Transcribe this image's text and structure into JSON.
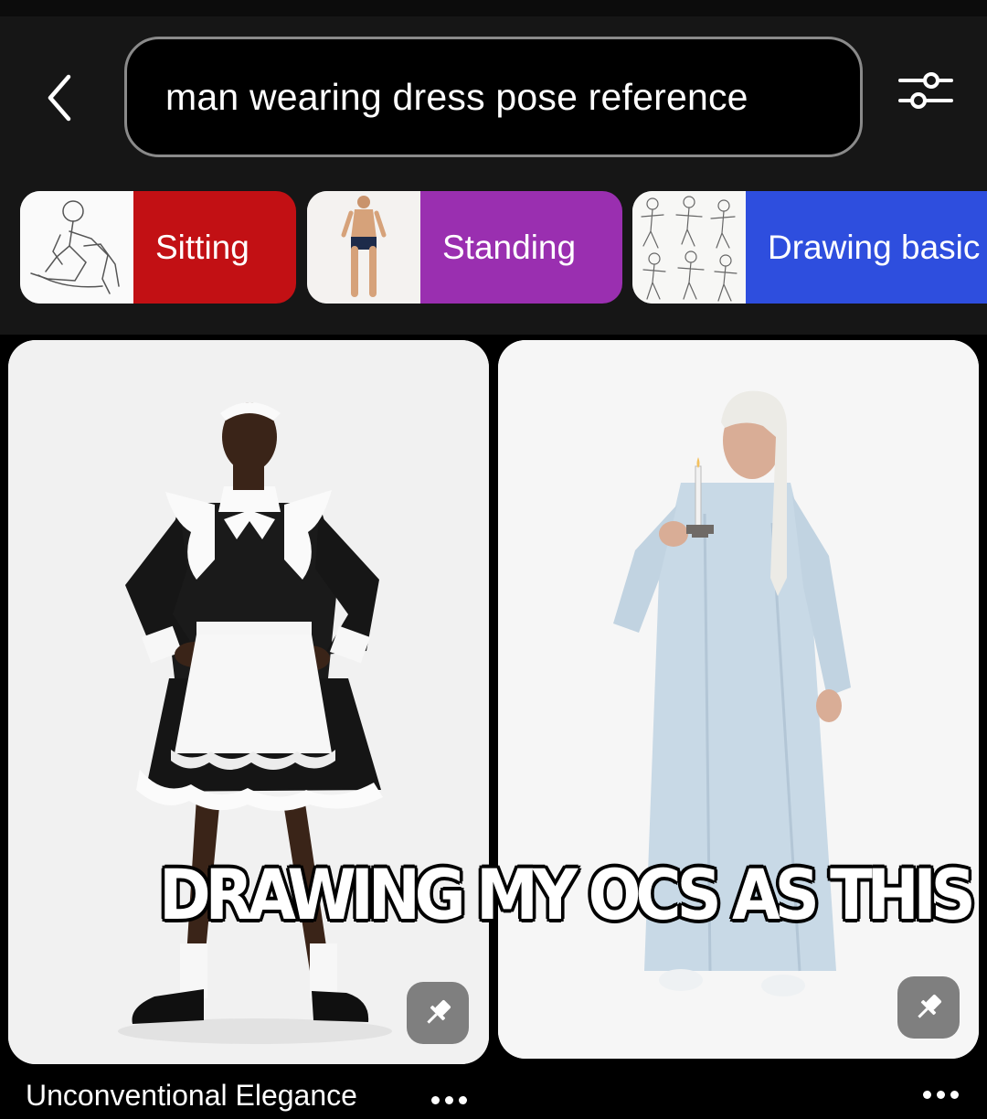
{
  "search": {
    "query": "man wearing dress pose reference"
  },
  "icons": {
    "back": "chevron-left-icon",
    "filter": "sliders-filter-icon",
    "pin_action": "pushpin-icon",
    "more": "ellipsis-icon"
  },
  "chips": [
    {
      "label": "Sitting",
      "color": "#c21014"
    },
    {
      "label": "Standing",
      "color": "#9a2fb0"
    },
    {
      "label": "Drawing basic",
      "color": "#2e4ede"
    }
  ],
  "meme_caption": "DRAWING MY OCS AS THIS",
  "board_title": "Unconventional Elegance"
}
